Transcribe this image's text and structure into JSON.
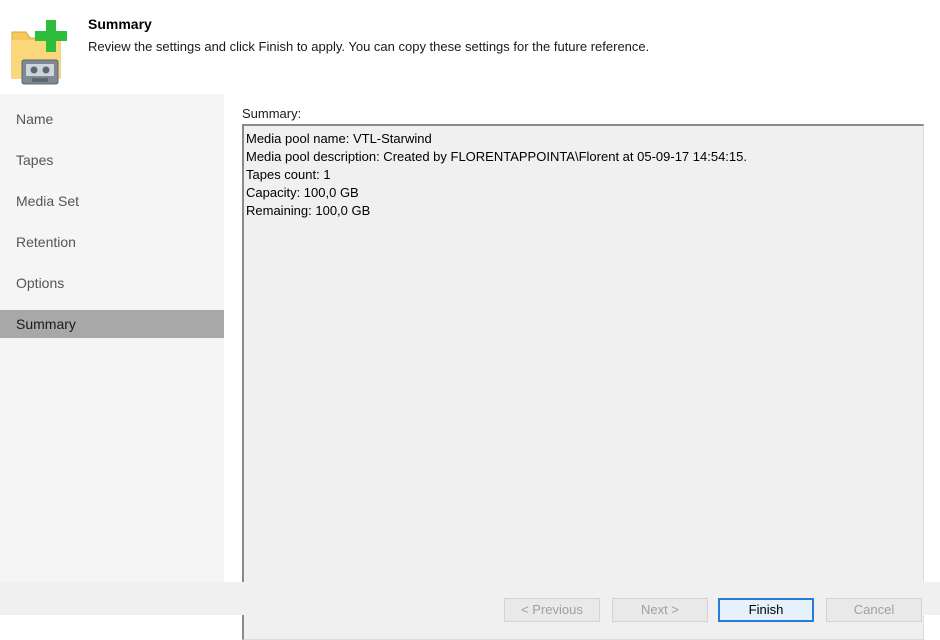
{
  "header": {
    "title": "Summary",
    "description": "Review the settings and click Finish to apply. You can copy these settings for the future reference.",
    "icon": "media-pool-add-icon"
  },
  "sidebar": {
    "items": [
      {
        "label": "Name"
      },
      {
        "label": "Tapes"
      },
      {
        "label": "Media Set"
      },
      {
        "label": "Retention"
      },
      {
        "label": "Options"
      },
      {
        "label": "Summary",
        "active": true
      }
    ]
  },
  "main": {
    "summary_label": "Summary:",
    "summary_lines": [
      "Media pool name: VTL-Starwind",
      "Media pool description: Created by FLORENTAPPOINTA\\Florent at 05-09-17 14:54:15.",
      "Tapes count: 1",
      "Capacity: 100,0 GB",
      "Remaining: 100,0 GB"
    ]
  },
  "footer": {
    "previous_label": "< Previous",
    "next_label": "Next >",
    "finish_label": "Finish",
    "cancel_label": "Cancel"
  },
  "colors": {
    "active_nav_bg": "#a8a8a8",
    "sidebar_bg": "#f5f5f5",
    "accent_blue": "#2a7bd5",
    "plus_green": "#2ebd3c",
    "folder_yellow": "#f6c95c"
  }
}
